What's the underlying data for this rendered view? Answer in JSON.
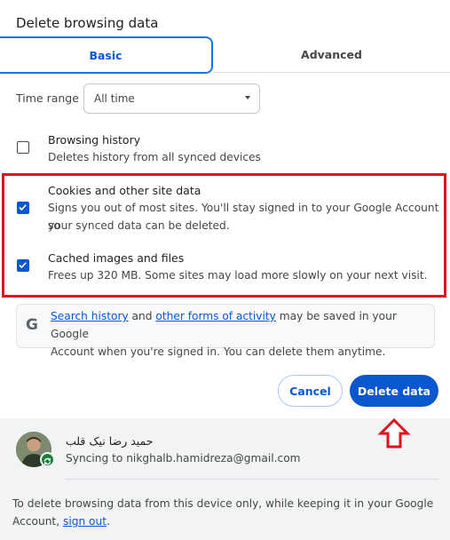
{
  "dialog": {
    "title": "Delete browsing data"
  },
  "tabs": [
    {
      "label": "Basic",
      "selected": true
    },
    {
      "label": "Advanced",
      "selected": false
    }
  ],
  "time_range": {
    "label": "Time range",
    "value": "All time"
  },
  "options": [
    {
      "title": "Browsing history",
      "description": "Deletes history from all synced devices",
      "checked": false
    },
    {
      "title": "Cookies and other site data",
      "description_line1": "Signs you out of most sites. You'll stay signed in to your Google Account so",
      "description_line2": "your synced data can be deleted.",
      "checked": true
    },
    {
      "title": "Cached images and files",
      "description": "Frees up 320 MB. Some sites may load more slowly on your next visit.",
      "checked": true
    }
  ],
  "info": {
    "link1": "Search history",
    "text1": " and ",
    "link2": "other forms of activity",
    "text2": " may be saved in your Google",
    "line2": "Account when you're signed in. You can delete them anytime."
  },
  "buttons": {
    "cancel": "Cancel",
    "delete": "Delete data"
  },
  "account": {
    "name": "حمید رضا نیک قلب",
    "sync_text": "Syncing to nikghalb.hamidreza@gmail.com"
  },
  "footer": {
    "line1": "To delete browsing data from this device only, while keeping it in your Google",
    "line2_prefix": "Account, ",
    "sign_out": "sign out",
    "line2_suffix": "."
  },
  "colors": {
    "accent": "#0b57d0",
    "highlight": "#e0121d",
    "sync": "#188038"
  }
}
